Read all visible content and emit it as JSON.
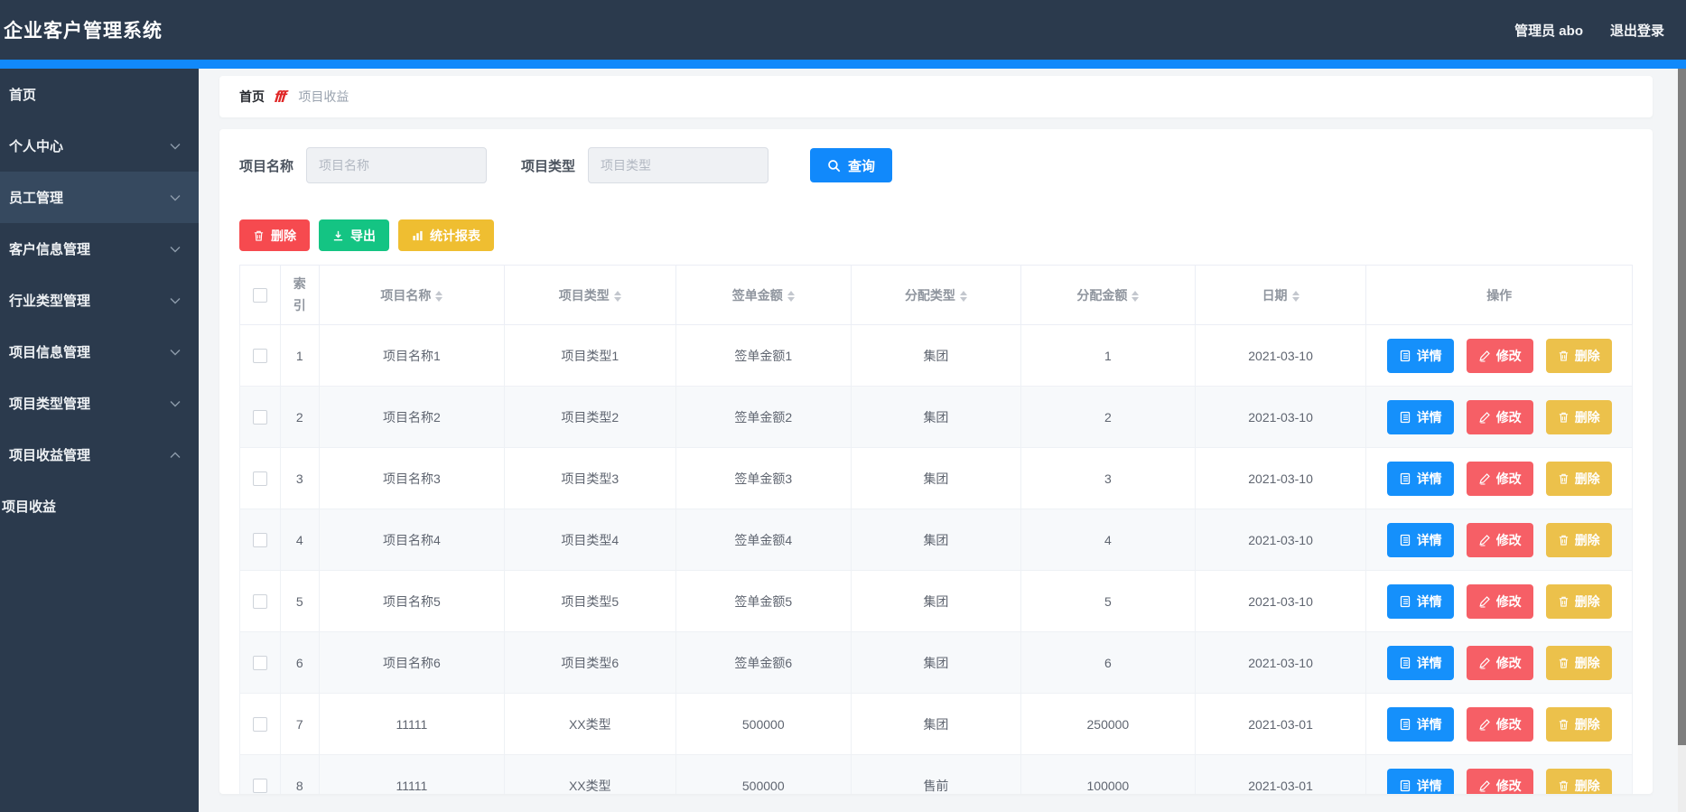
{
  "app": {
    "title": "企业客户管理系统"
  },
  "topbar": {
    "user": "管理员 abo",
    "logout": "退出登录"
  },
  "sidebar": {
    "items": [
      {
        "key": "home",
        "label": "首页",
        "chevron": null,
        "active": false,
        "child": false
      },
      {
        "key": "personal-center",
        "label": "个人中心",
        "chevron": "down",
        "active": false,
        "child": false
      },
      {
        "key": "employee-management",
        "label": "员工管理",
        "chevron": "down",
        "active": true,
        "child": false
      },
      {
        "key": "customer-info-management",
        "label": "客户信息管理",
        "chevron": "down",
        "active": false,
        "child": false
      },
      {
        "key": "industry-type-management",
        "label": "行业类型管理",
        "chevron": "down",
        "active": false,
        "child": false
      },
      {
        "key": "project-info-management",
        "label": "项目信息管理",
        "chevron": "down",
        "active": false,
        "child": false
      },
      {
        "key": "project-type-management",
        "label": "项目类型管理",
        "chevron": "down",
        "active": false,
        "child": false
      },
      {
        "key": "project-income-management",
        "label": "项目收益管理",
        "chevron": "up",
        "active": false,
        "child": false
      },
      {
        "key": "project-income",
        "label": "项目收益",
        "chevron": null,
        "active": false,
        "child": true
      }
    ]
  },
  "breadcrumb": {
    "home": "首页",
    "separator": "fff",
    "current": "项目收益"
  },
  "filters": {
    "name_label": "项目名称",
    "name_placeholder": "项目名称",
    "type_label": "项目类型",
    "type_placeholder": "项目类型",
    "search_label": "查询",
    "search_icon": "search-icon"
  },
  "toolbar": {
    "delete_label": "删除",
    "delete_icon": "trash-icon",
    "export_label": "导出",
    "export_icon": "download-icon",
    "report_label": "统计报表",
    "report_icon": "bar-chart-icon"
  },
  "table": {
    "headers": [
      {
        "key": "checkbox",
        "label": "",
        "sortable": false
      },
      {
        "key": "index",
        "label": "索引",
        "sortable": false
      },
      {
        "key": "name",
        "label": "项目名称",
        "sortable": true
      },
      {
        "key": "type",
        "label": "项目类型",
        "sortable": true
      },
      {
        "key": "sign_amount",
        "label": "签单金额",
        "sortable": true
      },
      {
        "key": "alloc_type",
        "label": "分配类型",
        "sortable": true
      },
      {
        "key": "alloc_amount",
        "label": "分配金额",
        "sortable": true
      },
      {
        "key": "date",
        "label": "日期",
        "sortable": true
      },
      {
        "key": "actions",
        "label": "操作",
        "sortable": false
      }
    ],
    "actions": [
      {
        "key": "detail",
        "label": "详情",
        "icon": "document-icon",
        "color": "#1590fb"
      },
      {
        "key": "edit",
        "label": "修改",
        "icon": "edit-icon",
        "color": "#f65f66"
      },
      {
        "key": "delete",
        "label": "删除",
        "icon": "trash-icon",
        "color": "#ecc14b"
      }
    ],
    "rows": [
      {
        "index": "1",
        "name": "项目名称1",
        "type": "项目类型1",
        "sign_amount": "签单金额1",
        "alloc_type": "集团",
        "alloc_amount": "1",
        "date": "2021-03-10"
      },
      {
        "index": "2",
        "name": "项目名称2",
        "type": "项目类型2",
        "sign_amount": "签单金额2",
        "alloc_type": "集团",
        "alloc_amount": "2",
        "date": "2021-03-10"
      },
      {
        "index": "3",
        "name": "项目名称3",
        "type": "项目类型3",
        "sign_amount": "签单金额3",
        "alloc_type": "集团",
        "alloc_amount": "3",
        "date": "2021-03-10"
      },
      {
        "index": "4",
        "name": "项目名称4",
        "type": "项目类型4",
        "sign_amount": "签单金额4",
        "alloc_type": "集团",
        "alloc_amount": "4",
        "date": "2021-03-10"
      },
      {
        "index": "5",
        "name": "项目名称5",
        "type": "项目类型5",
        "sign_amount": "签单金额5",
        "alloc_type": "集团",
        "alloc_amount": "5",
        "date": "2021-03-10"
      },
      {
        "index": "6",
        "name": "项目名称6",
        "type": "项目类型6",
        "sign_amount": "签单金额6",
        "alloc_type": "集团",
        "alloc_amount": "6",
        "date": "2021-03-10"
      },
      {
        "index": "7",
        "name": "11111",
        "type": "XX类型",
        "sign_amount": "500000",
        "alloc_type": "集团",
        "alloc_amount": "250000",
        "date": "2021-03-01"
      },
      {
        "index": "8",
        "name": "11111",
        "type": "XX类型",
        "sign_amount": "500000",
        "alloc_type": "售前",
        "alloc_amount": "100000",
        "date": "2021-03-01"
      }
    ]
  },
  "colors": {
    "header_navy": "#2b3a4d",
    "accent_blue": "#1189fb",
    "danger_red": "#f64a4f",
    "success_green": "#14c483",
    "warning_yellow": "#efbe31",
    "row_edit_red": "#f65f66",
    "row_delete_yellow": "#ecc14b"
  }
}
